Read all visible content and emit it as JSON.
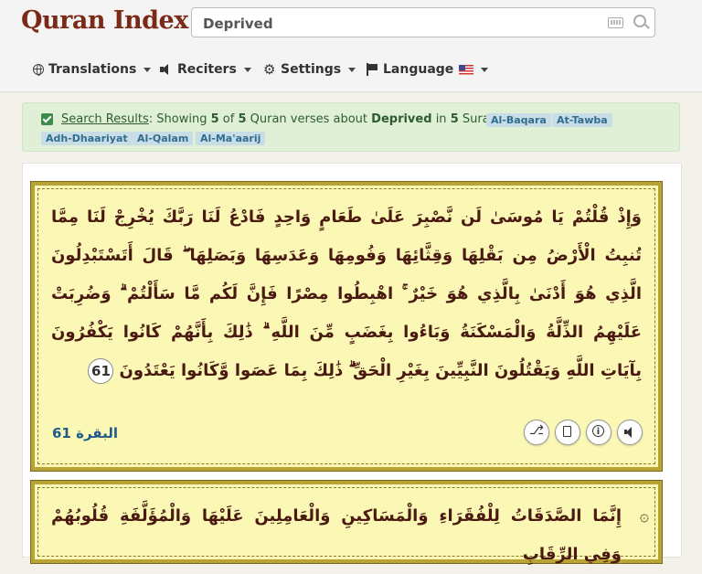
{
  "header": {
    "logo": "Quran Index",
    "search": {
      "value": "Deprived",
      "placeholder": ""
    },
    "nav": [
      {
        "label": "Translations",
        "icon": "globe-icon"
      },
      {
        "label": "Reciters",
        "icon": "speaker-icon"
      },
      {
        "label": "Settings",
        "icon": "gear-icon"
      },
      {
        "label": "Language",
        "icon": "flag-icon"
      }
    ]
  },
  "results": {
    "link": "Search Results",
    "showing": "Showing",
    "count": "5",
    "of": "of",
    "total": "5",
    "phrase_mid": "Quran verses about",
    "query": "Deprived",
    "in": "in",
    "surah_count": "5",
    "surahs_word": "Surahs",
    "tags": [
      "Al-Baqara",
      "At-Tawba",
      "Adh-Dhaariyat",
      "Al-Qalam",
      "Al-Ma'aarij"
    ]
  },
  "verses": [
    {
      "text": "وَإِذْ قُلْتُمْ يَا مُوسَىٰ لَن نَّصْبِرَ عَلَىٰ طَعَامٍ وَاحِدٍ فَادْعُ لَنَا رَبَّكَ يُخْرِجْ لَنَا مِمَّا تُنبِتُ الْأَرْضُ مِن بَقْلِهَا وَقِثَّائِهَا وَفُومِهَا وَعَدَسِهَا وَبَصَلِهَا ۖ قَالَ أَتَسْتَبْدِلُونَ الَّذِي هُوَ أَدْنَىٰ بِالَّذِي هُوَ خَيْرٌ ۚ اهْبِطُوا مِصْرًا فَإِنَّ لَكُم مَّا سَأَلْتُمْ ۗ وَضُرِبَتْ عَلَيْهِمُ الذِّلَّةُ وَالْمَسْكَنَةُ وَبَاءُوا بِغَضَبٍ مِّنَ اللَّهِ ۗ ذَٰلِكَ بِأَنَّهُمْ كَانُوا يَكْفُرُونَ بِآيَاتِ اللَّهِ وَيَقْتُلُونَ النَّبِيِّينَ بِغَيْرِ الْحَقِّ ۗ ذَٰلِكَ بِمَا عَصَوا وَّكَانُوا يَعْتَدُونَ",
      "number": "61",
      "reference": "البقرة 61"
    },
    {
      "text": "إِنَّمَا الصَّدَقَاتُ لِلْفُقَرَاءِ وَالْمَسَاكِينِ وَالْعَامِلِينَ عَلَيْهَا وَالْمُؤَلَّفَةِ قُلُوبُهُمْ وَفِي الرِّقَابِ"
    }
  ],
  "colors": {
    "accent": "#7a2a17",
    "card_bg": "#fbf7b5",
    "card_border": "#b9a337",
    "success_bg": "#dff0d7",
    "tag_bg": "#c9dde7",
    "ref": "#1f5c8a"
  }
}
